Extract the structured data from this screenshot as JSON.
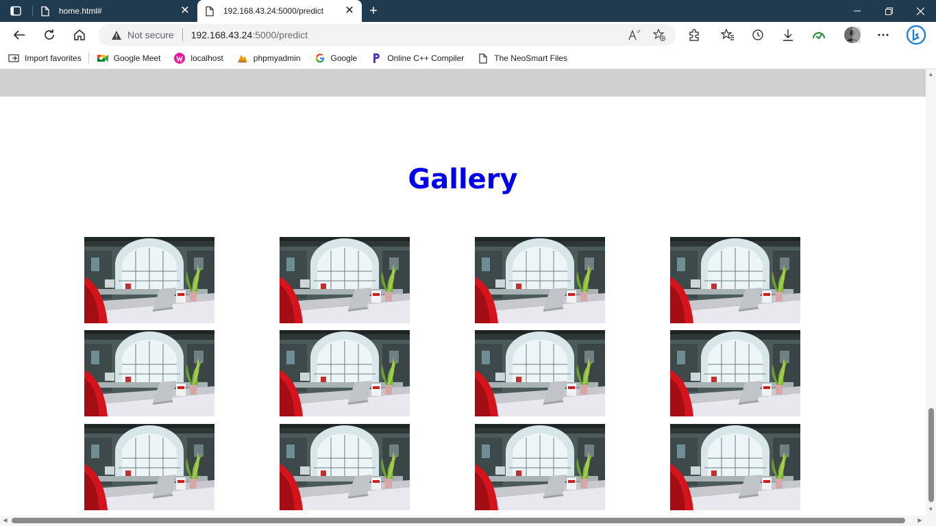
{
  "browser": {
    "tabs": [
      {
        "title": "home.html#",
        "active": false
      },
      {
        "title": "192.168.43.24:5000/predict",
        "active": true
      }
    ],
    "address": {
      "security_label": "Not secure",
      "host": "192.168.43.24",
      "path": ":5000/predict"
    },
    "favorites": [
      {
        "label": "Import favorites",
        "icon": "import-icon"
      },
      {
        "label": "Google Meet",
        "icon": "google-meet-icon"
      },
      {
        "label": "localhost",
        "icon": "localhost-icon"
      },
      {
        "label": "phpmyadmin",
        "icon": "phpmyadmin-icon"
      },
      {
        "label": "Google",
        "icon": "google-icon"
      },
      {
        "label": "Online C++ Compiler",
        "icon": "programiz-icon"
      },
      {
        "label": "The NeoSmart Files",
        "icon": "page-icon"
      }
    ]
  },
  "page": {
    "title": "Gallery",
    "title_color": "#0000ee",
    "images": [
      {
        "alt": "office workspace photo"
      },
      {
        "alt": "office workspace photo"
      },
      {
        "alt": "office workspace photo"
      },
      {
        "alt": "office workspace photo"
      },
      {
        "alt": "office workspace photo"
      },
      {
        "alt": "office workspace photo"
      },
      {
        "alt": "office workspace photo"
      },
      {
        "alt": "office workspace photo"
      },
      {
        "alt": "office workspace photo"
      },
      {
        "alt": "office workspace photo"
      },
      {
        "alt": "office workspace photo"
      },
      {
        "alt": "office workspace photo"
      }
    ]
  },
  "colors": {
    "tabstrip": "#203a4f",
    "band": "#d0d0d0"
  }
}
